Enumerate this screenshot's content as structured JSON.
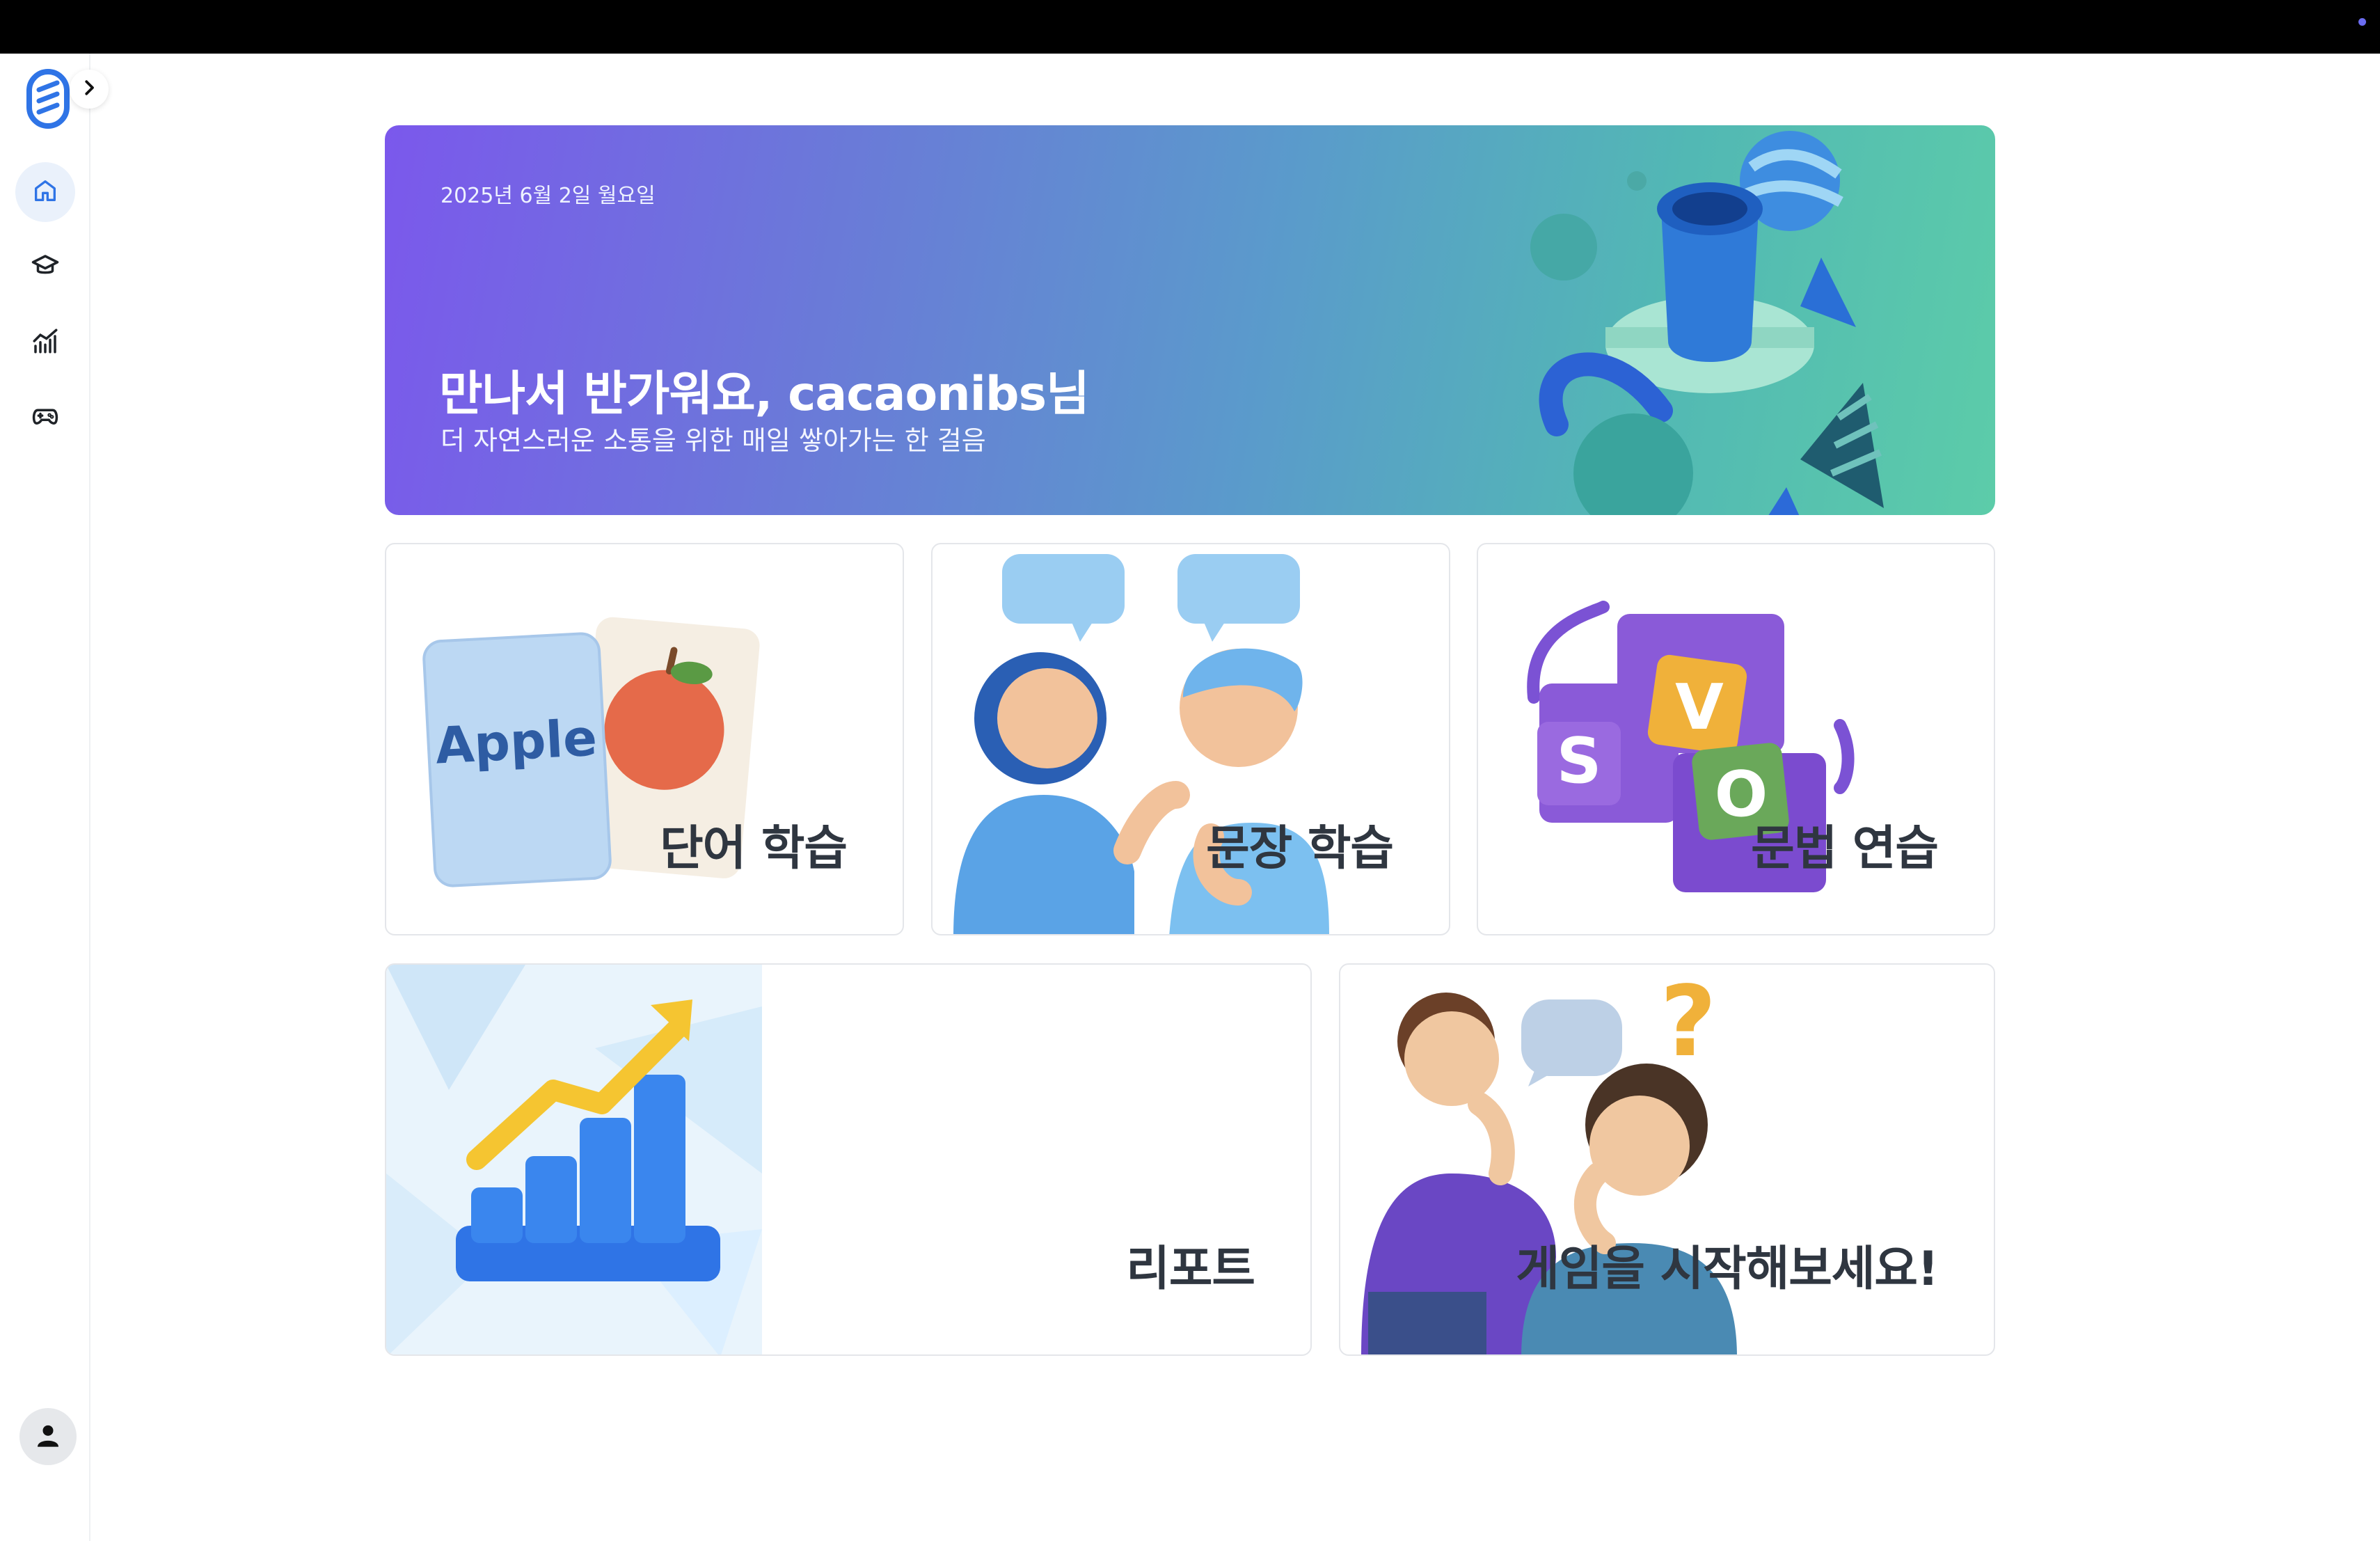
{
  "banner": {
    "date": "2025년 6월 2일 월요일",
    "greeting": "만나서 반가워요, cacaonibs님",
    "subtitle": "더 자연스러운 소통을 위한 매일 쌓아가는 한 걸음"
  },
  "sidebar": {
    "items": [
      {
        "icon": "home-icon",
        "active": true
      },
      {
        "icon": "graduation-cap-icon",
        "active": false
      },
      {
        "icon": "chart-icon",
        "active": false
      },
      {
        "icon": "gamepad-icon",
        "active": false
      }
    ],
    "profile_icon": "user-icon"
  },
  "cards": {
    "word": {
      "label": "단어 학습",
      "image_text": "Apple"
    },
    "sentence": {
      "label": "문장 학습"
    },
    "grammar": {
      "label": "문법 연습",
      "tiles": [
        "V",
        "S",
        "O"
      ]
    },
    "report": {
      "label": "리포트"
    },
    "game": {
      "label": "게임을 시작해보세요!"
    }
  },
  "colors": {
    "accent": "#2f74e6",
    "banner_start": "#7b58ec",
    "banner_end": "#5ccca9"
  }
}
